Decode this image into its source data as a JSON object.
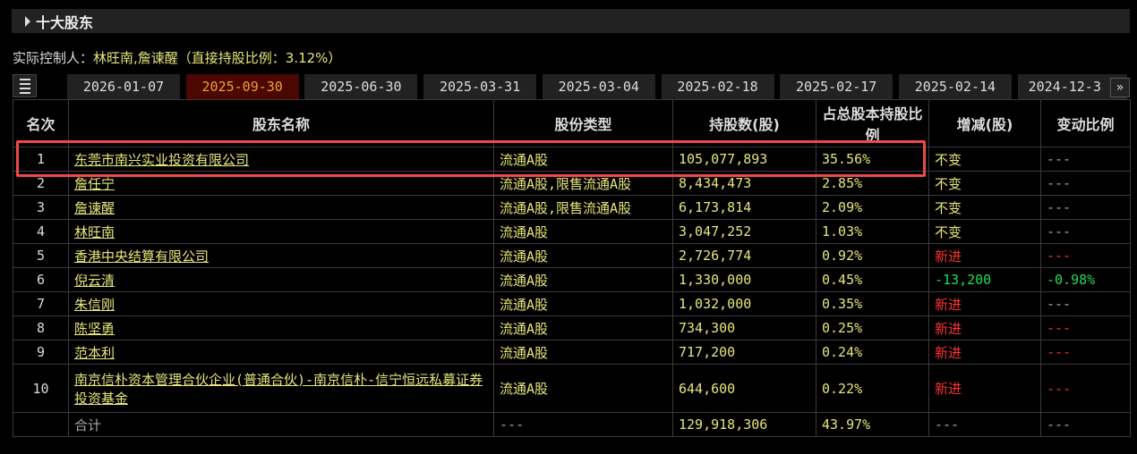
{
  "section_title": "十大股东",
  "controller": {
    "label": "实际控制人：",
    "value": "林旺南,詹谏醒（直接持股比例：3.12%）"
  },
  "tabs": [
    "2026-01-07",
    "2025-09-30",
    "2025-06-30",
    "2025-03-31",
    "2025-03-04",
    "2025-02-18",
    "2025-02-17",
    "2025-02-14",
    "2024-12-3"
  ],
  "active_tab": 1,
  "more_label": "»",
  "headers": [
    "名次",
    "股东名称",
    "股份类型",
    "持股数(股)",
    "占总股本持股比例",
    "增减(股)",
    "变动比例"
  ],
  "rows": [
    {
      "rank": "1",
      "name": "东莞市南兴实业投资有限公司",
      "type": "流通A股",
      "shares": "105,077,893",
      "pct": "35.56%",
      "change": "不变",
      "change_pct": "---"
    },
    {
      "rank": "2",
      "name": "詹任宁",
      "type": "流通A股,限售流通A股",
      "shares": "8,434,473",
      "pct": "2.85%",
      "change": "不变",
      "change_pct": "---"
    },
    {
      "rank": "3",
      "name": "詹谏醒",
      "type": "流通A股,限售流通A股",
      "shares": "6,173,814",
      "pct": "2.09%",
      "change": "不变",
      "change_pct": "---"
    },
    {
      "rank": "4",
      "name": "林旺南",
      "type": "流通A股",
      "shares": "3,047,252",
      "pct": "1.03%",
      "change": "不变",
      "change_pct": "---"
    },
    {
      "rank": "5",
      "name": "香港中央结算有限公司",
      "type": "流通A股",
      "shares": "2,726,774",
      "pct": "0.92%",
      "change": "新进",
      "change_pct": "---"
    },
    {
      "rank": "6",
      "name": "倪云清",
      "type": "流通A股",
      "shares": "1,330,000",
      "pct": "0.45%",
      "change": "-13,200",
      "change_pct": "-0.98%"
    },
    {
      "rank": "7",
      "name": "朱信刚",
      "type": "流通A股",
      "shares": "1,032,000",
      "pct": "0.35%",
      "change": "新进",
      "change_pct": "---"
    },
    {
      "rank": "8",
      "name": "陈坚勇",
      "type": "流通A股",
      "shares": "734,300",
      "pct": "0.25%",
      "change": "新进",
      "change_pct": "---"
    },
    {
      "rank": "9",
      "name": "范本利",
      "type": "流通A股",
      "shares": "717,200",
      "pct": "0.24%",
      "change": "新进",
      "change_pct": "---"
    },
    {
      "rank": "10",
      "name": "南京信朴资本管理合伙企业(普通合伙)-南京信朴-信宁恒远私募证券投资基金",
      "type": "流通A股",
      "shares": "644,600",
      "pct": "0.22%",
      "change": "新进",
      "change_pct": "---"
    }
  ],
  "total": {
    "label": "合计",
    "type": "---",
    "shares": "129,918,306",
    "pct": "43.97%",
    "change": "---",
    "change_pct": "---"
  }
}
